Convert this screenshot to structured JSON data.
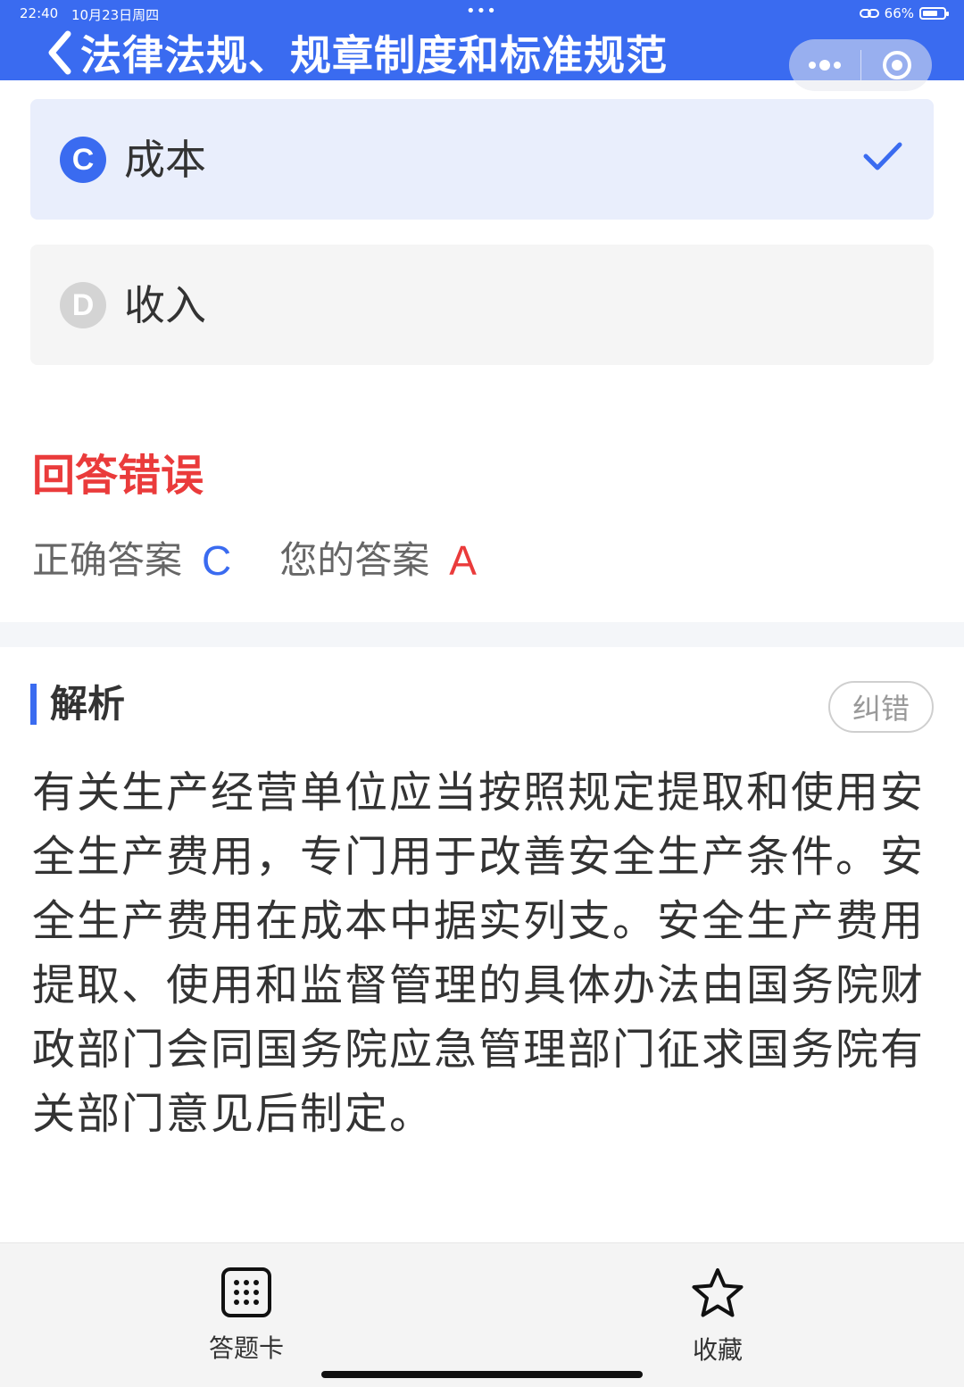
{
  "status_bar": {
    "time": "22:40",
    "date": "10月23日周四",
    "center_dots": "•••",
    "battery_percent": "66%",
    "wifi_icon": "link-icon"
  },
  "header": {
    "title": "法律法规、规章制度和标准规范",
    "back_icon": "chevron-left-icon",
    "more_icon": "more-dots-icon",
    "close_icon": "target-close-icon",
    "bg_color": "#3a6bf0"
  },
  "options": [
    {
      "letter": "C",
      "text": "成本",
      "selected": true,
      "badge_color": "#3a6bf0"
    },
    {
      "letter": "D",
      "text": "收入",
      "selected": false,
      "badge_color": "#d4d4d4"
    }
  ],
  "result": {
    "title": "回答错误",
    "correct_label": "正确答案",
    "correct_value": "C",
    "yours_label": "您的答案",
    "yours_value": "A",
    "wrong_color": "#ea3b3b",
    "correct_color": "#3a6bf0"
  },
  "analysis": {
    "heading": "解析",
    "report_label": "纠错",
    "text": "有关生产经营单位应当按照规定提取和使用安全生产费用，专门用于改善安全生产条件。安全生产费用在成本中据实列支。安全生产费用提取、使用和监督管理的具体办法由国务院财政部门会同国务院应急管理部门征求国务院有关部门意见后制定。"
  },
  "bottom_bar": {
    "answer_card_label": "答题卡",
    "favorite_label": "收藏"
  }
}
